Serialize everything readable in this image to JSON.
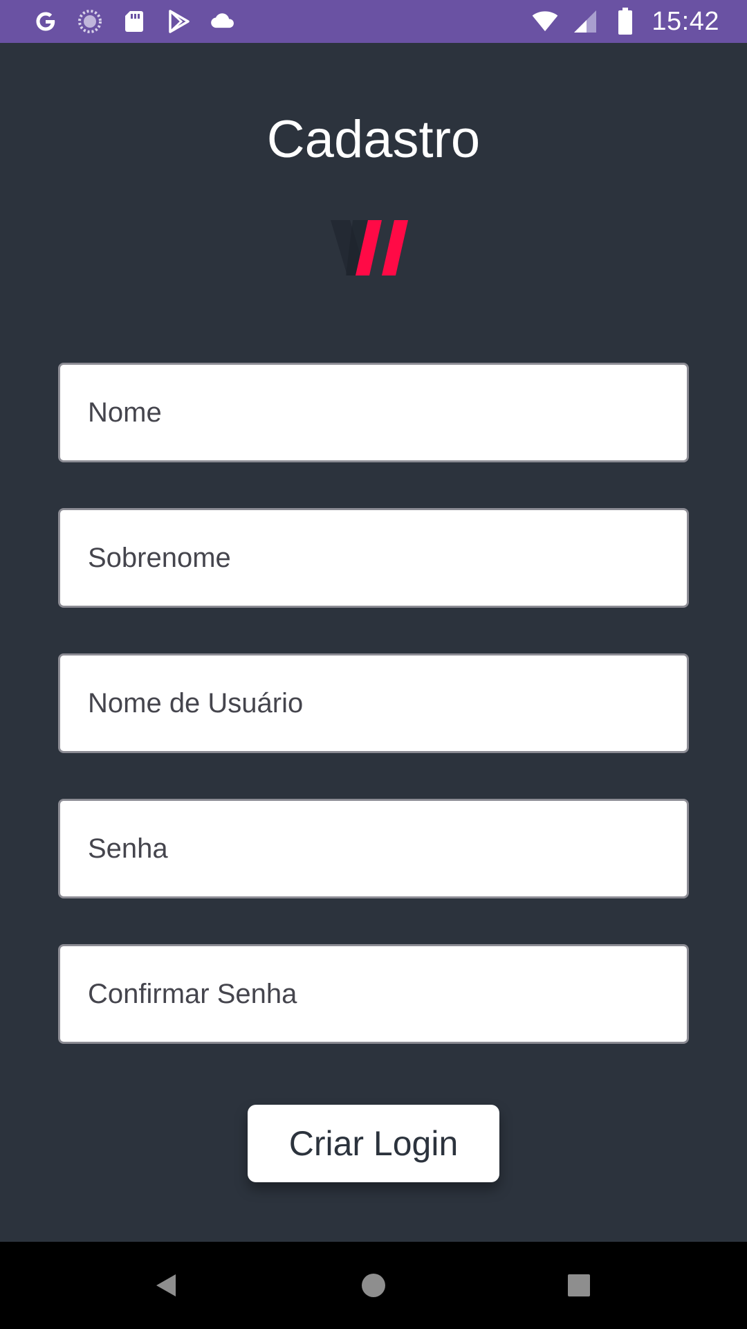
{
  "status_bar": {
    "time": "15:42",
    "left_icons": [
      "google-icon",
      "loading-icon",
      "sd-card-icon",
      "play-store-icon",
      "cloud-icon"
    ],
    "right_icons": [
      "wifi-icon",
      "cellular-signal-icon",
      "battery-icon"
    ],
    "background": "#6a52a3"
  },
  "page": {
    "title": "Cadastro",
    "background": "#2c333d",
    "logo": "double-slash-logo",
    "accent": "#ff0a46"
  },
  "form": {
    "fields": [
      {
        "name": "nome",
        "placeholder": "Nome",
        "value": ""
      },
      {
        "name": "sobrenome",
        "placeholder": "Sobrenome",
        "value": ""
      },
      {
        "name": "usuario",
        "placeholder": "Nome de Usuário",
        "value": ""
      },
      {
        "name": "senha",
        "placeholder": "Senha",
        "value": ""
      },
      {
        "name": "confirmar_senha",
        "placeholder": "Confirmar Senha",
        "value": ""
      }
    ],
    "submit_label": "Criar Login"
  },
  "nav_bar": {
    "buttons": [
      "back-icon",
      "home-icon",
      "recents-icon"
    ]
  }
}
